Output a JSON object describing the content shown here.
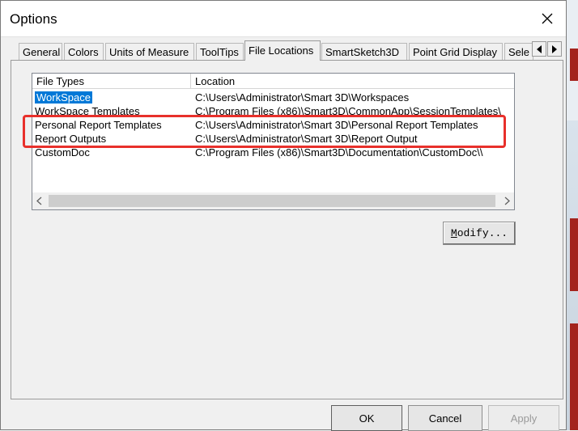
{
  "window": {
    "title": "Options"
  },
  "tabs": [
    {
      "label": "General",
      "active": false
    },
    {
      "label": "Colors",
      "active": false
    },
    {
      "label": "Units of Measure",
      "active": false
    },
    {
      "label": "ToolTips",
      "active": false
    },
    {
      "label": "File Locations",
      "active": true
    },
    {
      "label": "SmartSketch3D",
      "active": false
    },
    {
      "label": "Point Grid Display",
      "active": false
    },
    {
      "label": "Sele",
      "active": false
    }
  ],
  "file_list": {
    "columns": [
      "File Types",
      "Location"
    ],
    "rows": [
      {
        "type": "WorkSpace",
        "location": "C:\\Users\\Administrator\\Smart 3D\\Workspaces",
        "selected": true
      },
      {
        "type": "WorkSpace Templates",
        "location": "C:\\Program Files (x86)\\Smart3D\\CommonApp\\SessionTemplates\\",
        "selected": false
      },
      {
        "type": "Personal Report Templates",
        "location": "C:\\Users\\Administrator\\Smart 3D\\Personal Report Templates",
        "selected": false
      },
      {
        "type": "Report Outputs",
        "location": "C:\\Users\\Administrator\\Smart 3D\\Report Output",
        "selected": false
      },
      {
        "type": "CustomDoc",
        "location": "C:\\Program Files (x86)\\Smart3D\\Documentation\\CustomDoc\\\\",
        "selected": false
      }
    ]
  },
  "buttons": {
    "modify_mnemonic": "M",
    "modify_rest": "odify...",
    "ok": "OK",
    "cancel": "Cancel",
    "apply": "Apply"
  },
  "colors": {
    "selection": "#0078d7",
    "highlight_annotation": "#e8302b"
  }
}
